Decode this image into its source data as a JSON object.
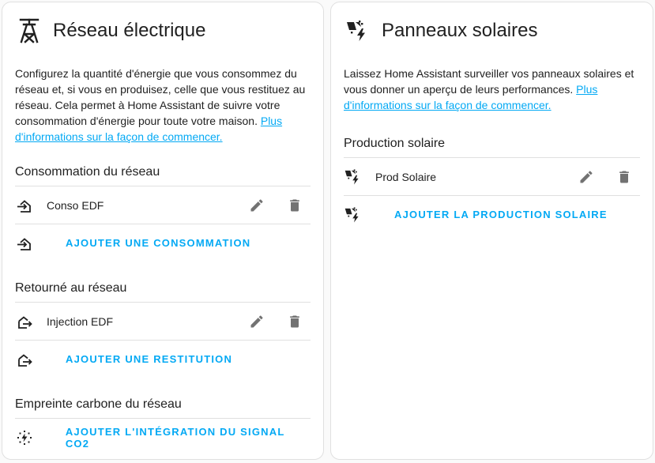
{
  "grid": {
    "title": "Réseau électrique",
    "description": "Configurez la quantité d'énergie que vous consommez du réseau et, si vous en produisez, celle que vous restituez au réseau. Cela permet à Home Assistant de suivre votre consommation d'énergie pour toute votre maison.",
    "link_text": "Plus d'informations sur la façon de commencer.",
    "consumption": {
      "title": "Consommation du réseau",
      "items": [
        {
          "label": "Conso EDF"
        }
      ],
      "add_label": "AJOUTER UNE CONSOMMATION"
    },
    "return": {
      "title": "Retourné au réseau",
      "items": [
        {
          "label": "Injection EDF"
        }
      ],
      "add_label": "AJOUTER UNE RESTITUTION"
    },
    "carbon": {
      "title": "Empreinte carbone du réseau",
      "add_label": "AJOUTER L'INTÉGRATION DU SIGNAL CO2"
    }
  },
  "solar": {
    "title": "Panneaux solaires",
    "description": "Laissez Home Assistant surveiller vos panneaux solaires et vous donner un aperçu de leurs performances.",
    "link_text": "Plus d'informations sur la façon de commencer.",
    "production": {
      "title": "Production solaire",
      "items": [
        {
          "label": "Prod Solaire"
        }
      ],
      "add_label": "AJOUTER LA PRODUCTION SOLAIRE"
    }
  },
  "colors": {
    "accent": "#03a9f4",
    "icon": "#727272",
    "divider": "#e0e0e0"
  },
  "icons": {
    "grid": "transmission-tower-icon",
    "import": "home-import-icon",
    "export": "home-export-icon",
    "carbon": "carbon-signal-icon",
    "solar": "solar-power-icon",
    "edit": "pencil-icon",
    "delete": "delete-icon"
  }
}
